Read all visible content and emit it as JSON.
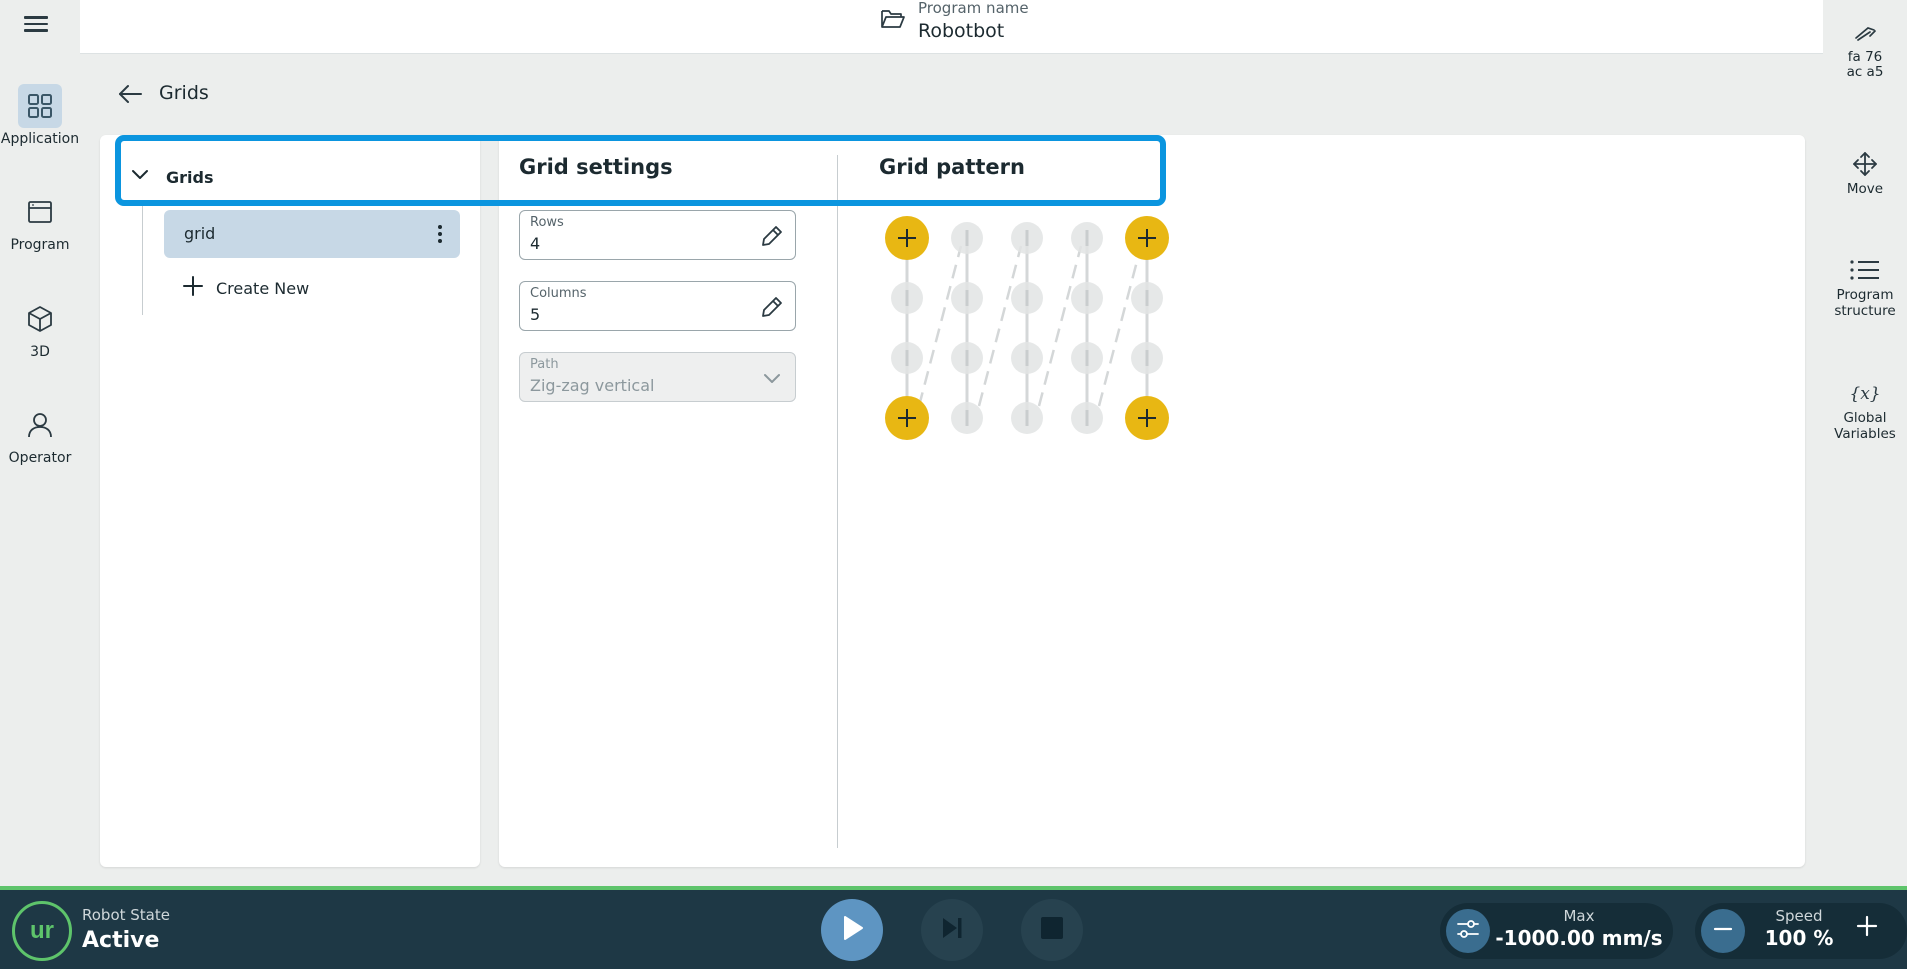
{
  "header": {
    "program_name_label": "Program name",
    "program_name": "Robotbot"
  },
  "left_nav": {
    "items": [
      {
        "label": "Application",
        "icon": "grid-apps-icon"
      },
      {
        "label": "Program",
        "icon": "window-icon"
      },
      {
        "label": "3D",
        "icon": "cube-icon"
      },
      {
        "label": "Operator",
        "icon": "person-icon"
      }
    ]
  },
  "right_nav": {
    "id_line1": "fa  76",
    "id_line2": "ac  a5",
    "items": [
      {
        "label": "Move",
        "icon": "move-arrows-icon"
      },
      {
        "label_line1": "Program",
        "label_line2": "structure",
        "icon": "list-icon"
      },
      {
        "label_line1": "Global",
        "label_line2": "Variables",
        "icon": "variable-icon"
      }
    ]
  },
  "page": {
    "title": "Grids"
  },
  "tree": {
    "group_label": "Grids",
    "items": [
      {
        "label": "grid"
      }
    ],
    "create_new": "Create New"
  },
  "settings": {
    "title": "Grid settings",
    "rows_label": "Rows",
    "rows_value": "4",
    "columns_label": "Columns",
    "columns_value": "5",
    "path_label": "Path",
    "path_value": "Zig-zag vertical"
  },
  "pattern": {
    "title": "Grid pattern",
    "rows": 4,
    "columns": 5,
    "corner_color": "#e8b713",
    "point_color": "#e2e4e4"
  },
  "bottom": {
    "robot_state_label": "Robot State",
    "robot_state_value": "Active",
    "logo_text": "ur",
    "max_label": "Max",
    "max_value": "-1000.00 mm/s",
    "speed_label": "Speed",
    "speed_value": "100 %"
  },
  "colors": {
    "accent_blue": "#0b95df",
    "active_green": "#5ec46b",
    "bottom_bar": "#1e3845"
  }
}
